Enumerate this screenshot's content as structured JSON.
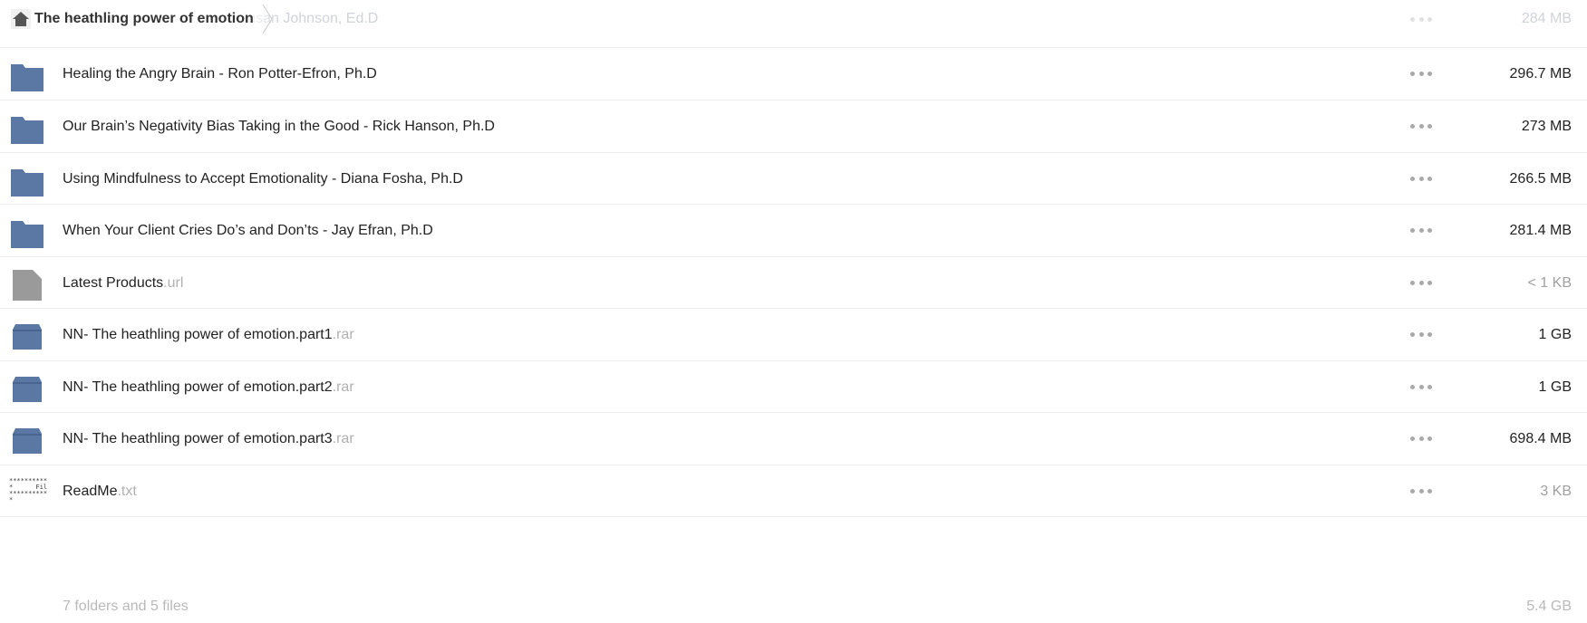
{
  "breadcrumb": {
    "title": "The heathling power of emotion"
  },
  "rows": [
    {
      "name": "…ice in Couples Therapy - Susan Johnson, Ed.D",
      "ext": "",
      "size": "284 MB",
      "icon": "folder-icon"
    },
    {
      "name": "Healing the Angry Brain - Ron Potter-Efron, Ph.D",
      "ext": "",
      "size": "296.7 MB",
      "icon": "folder-icon"
    },
    {
      "name": "Our Brain’s Negativity Bias Taking in the Good - Rick Hanson, Ph.D",
      "ext": "",
      "size": "273 MB",
      "icon": "folder-icon"
    },
    {
      "name": "Using Mindfulness to Accept Emotionality - Diana Fosha, Ph.D",
      "ext": "",
      "size": "266.5 MB",
      "icon": "folder-icon"
    },
    {
      "name": "When Your Client Cries Do’s and Don’ts - Jay Efran, Ph.D",
      "ext": "",
      "size": "281.4 MB",
      "icon": "folder-icon"
    },
    {
      "name": "Latest Products",
      "ext": ".url",
      "size": "< 1 KB",
      "icon": "file-icon"
    },
    {
      "name": "NN- The heathling power of emotion.part1",
      "ext": ".rar",
      "size": "1 GB",
      "icon": "archive-icon"
    },
    {
      "name": "NN- The heathling power of emotion.part2",
      "ext": ".rar",
      "size": "1 GB",
      "icon": "archive-icon"
    },
    {
      "name": "NN- The heathling power of emotion.part3",
      "ext": ".rar",
      "size": "698.4 MB",
      "icon": "archive-icon"
    },
    {
      "name": "ReadMe",
      "ext": ".txt",
      "size": "3 KB",
      "icon": "text-file-icon",
      "thumb": "**********\n*      File I\n**********\n*"
    }
  ],
  "summary": {
    "count": "7 folders and 5 files",
    "total": "5.4 GB"
  },
  "colors": {
    "folder": "#5a78a3",
    "generic_file": "#9a9a9a",
    "archive": "#5a78a3"
  }
}
